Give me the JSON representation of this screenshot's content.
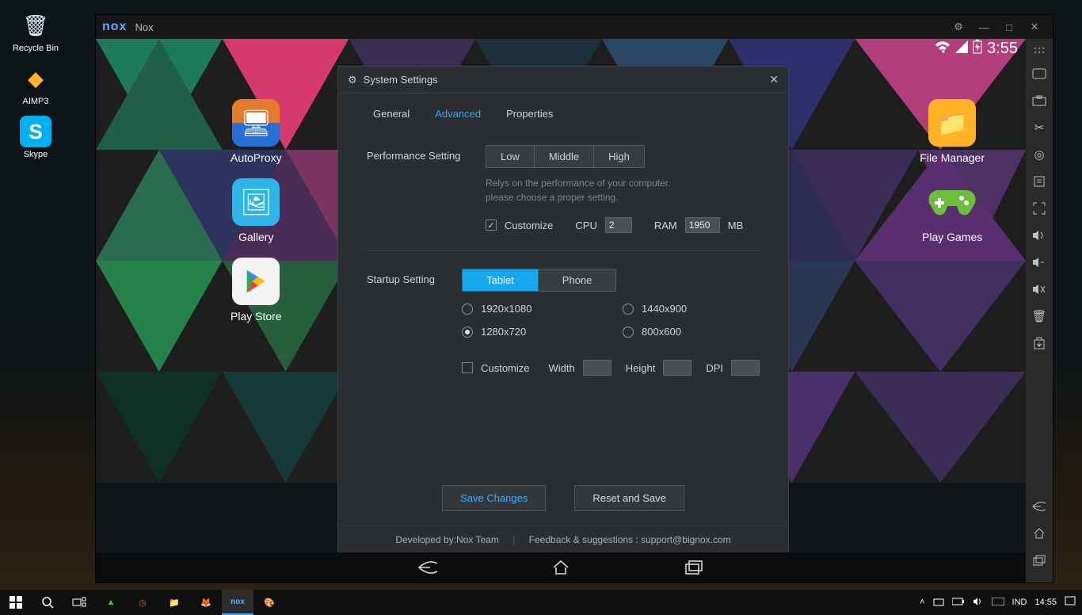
{
  "desktop": {
    "icons": [
      {
        "label": "Recycle Bin",
        "glyph": "🗑"
      },
      {
        "label": "AIMP3",
        "glyph": "▲"
      },
      {
        "label": "Skype",
        "glyph": "S"
      }
    ]
  },
  "taskbar": {
    "lang": "IND",
    "time": "14:55"
  },
  "nox": {
    "brand": "nox",
    "title": "Nox",
    "statusbar": {
      "time": "3:55"
    },
    "apps_left": [
      {
        "label": "AutoProxy",
        "bg": "#2a7ed6"
      },
      {
        "label": "Gallery",
        "bg": "#2fb4e8"
      },
      {
        "label": "Play Store",
        "bg": "#f3f3f3"
      }
    ],
    "apps_right": [
      {
        "label": "File Manager",
        "bg": "#ffb428"
      },
      {
        "label": "Play Games",
        "bg": "transparent"
      }
    ],
    "side_tools": [
      "drag",
      "keyboard",
      "screenshot",
      "scissors",
      "location",
      "notes",
      "fullscreen",
      "volume-up",
      "volume-down",
      "mute",
      "trash",
      "apk",
      "back",
      "home",
      "recents"
    ]
  },
  "settings": {
    "title": "System Settings",
    "tabs": {
      "general": "General",
      "advanced": "Advanced",
      "properties": "Properties",
      "active": "advanced"
    },
    "perf": {
      "label": "Performance Setting",
      "options": {
        "low": "Low",
        "middle": "Middle",
        "high": "High"
      },
      "hint1": "Relys on the performance of your computer.",
      "hint2": "please choose a proper setting.",
      "customize_label": "Customize",
      "customize_checked": true,
      "cpu_label": "CPU",
      "cpu_value": "2",
      "ram_label": "RAM",
      "ram_value": "1950",
      "ram_unit": "MB"
    },
    "startup": {
      "label": "Startup Setting",
      "tablet": "Tablet",
      "phone": "Phone",
      "active": "tablet",
      "resolutions": [
        {
          "label": "1920x1080",
          "checked": false
        },
        {
          "label": "1440x900",
          "checked": false
        },
        {
          "label": "1280x720",
          "checked": true
        },
        {
          "label": "800x600",
          "checked": false
        }
      ],
      "customize_label": "Customize",
      "customize_checked": false,
      "width_label": "Width",
      "width_value": "",
      "height_label": "Height",
      "height_value": "",
      "dpi_label": "DPI",
      "dpi_value": ""
    },
    "actions": {
      "save": "Save Changes",
      "reset": "Reset and Save"
    },
    "footer": {
      "dev": "Developed by:Nox Team",
      "feedback": "Feedback & suggestions : support@bignox.com"
    }
  }
}
